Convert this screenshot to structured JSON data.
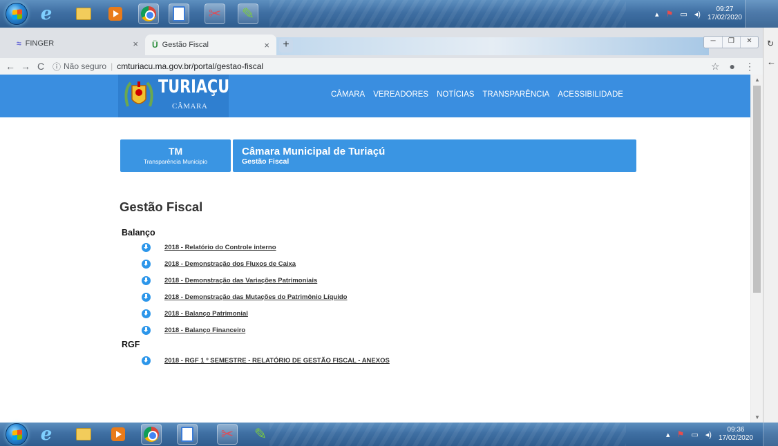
{
  "taskbar_top": {
    "time": "09:27",
    "date": "17/02/2020",
    "icons": [
      "windows-start-icon",
      "internet-explorer-icon",
      "file-explorer-icon",
      "media-player-icon",
      "chrome-icon",
      "document-icon",
      "snipping-tool-icon",
      "paint-icon"
    ]
  },
  "taskbar_bottom": {
    "time": "09:36",
    "date": "17/02/2020"
  },
  "browser": {
    "tabs": [
      {
        "title": "FINGER",
        "active": false
      },
      {
        "title": "Gestão Fiscal",
        "active": true
      }
    ],
    "security_label": "Não seguro",
    "url": "cmturiacu.ma.gov.br/portal/gestao-fiscal"
  },
  "site": {
    "logo_text": "TURIAÇU",
    "logo_subtext": "CÂMARA",
    "nav": [
      "CÂMARA",
      "VEREADORES",
      "NOTÍCIAS",
      "TRANSPARÊNCIA",
      "ACESSIBILIDADE"
    ],
    "tm_title": "TM",
    "tm_subtitle": "Transparência Municipio",
    "org_title": "Câmara Municipal de Turiaçú",
    "org_subtitle": "Gestão Fiscal",
    "brand_color": "#3a8ee0"
  },
  "content": {
    "page_title": "Gestão Fiscal",
    "groups": [
      {
        "heading": "Balanço",
        "items": [
          "2018 - Relatório do Controle interno",
          "2018 - Demonstração dos Fluxos de Caixa",
          "2018 - Demonstração das Variações Patrimoniais",
          "2018 - Demonstração das Mutações do Patrimônio Líquido",
          "2018 - Balanço Patrimonial",
          "2018 - Balanço Financeiro"
        ]
      },
      {
        "heading": "RGF",
        "items": [
          "2018 - RGF 1 º SEMESTRE - RELATÓRIO DE GESTÃO FISCAL - ANEXOS"
        ]
      }
    ]
  }
}
